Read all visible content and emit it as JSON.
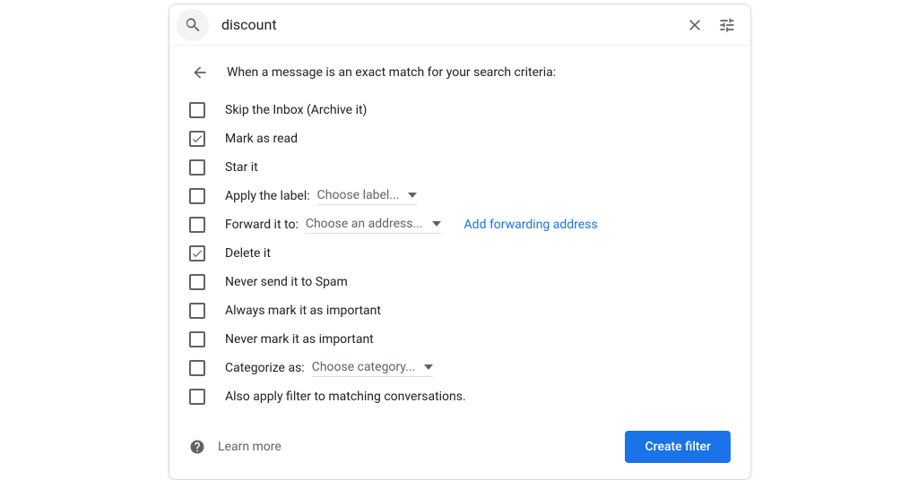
{
  "search": {
    "value": "discount"
  },
  "heading": "When a message is an exact match for your search criteria:",
  "options": {
    "skip_inbox": {
      "label": "Skip the Inbox (Archive it)",
      "checked": false
    },
    "mark_read": {
      "label": "Mark as read",
      "checked": true
    },
    "star": {
      "label": "Star it",
      "checked": false
    },
    "apply_label": {
      "label": "Apply the label:",
      "checked": false,
      "select_placeholder": "Choose label..."
    },
    "forward": {
      "label": "Forward it to:",
      "checked": false,
      "select_placeholder": "Choose an address...",
      "link": "Add forwarding address"
    },
    "delete": {
      "label": "Delete it",
      "checked": true
    },
    "never_spam": {
      "label": "Never send it to Spam",
      "checked": false
    },
    "always_important": {
      "label": "Always mark it as important",
      "checked": false
    },
    "never_important": {
      "label": "Never mark it as important",
      "checked": false
    },
    "categorize": {
      "label": "Categorize as:",
      "checked": false,
      "select_placeholder": "Choose category..."
    },
    "also_apply": {
      "label": "Also apply filter to matching conversations.",
      "checked": false
    }
  },
  "footer": {
    "learn_more": "Learn more",
    "create_button": "Create filter"
  }
}
